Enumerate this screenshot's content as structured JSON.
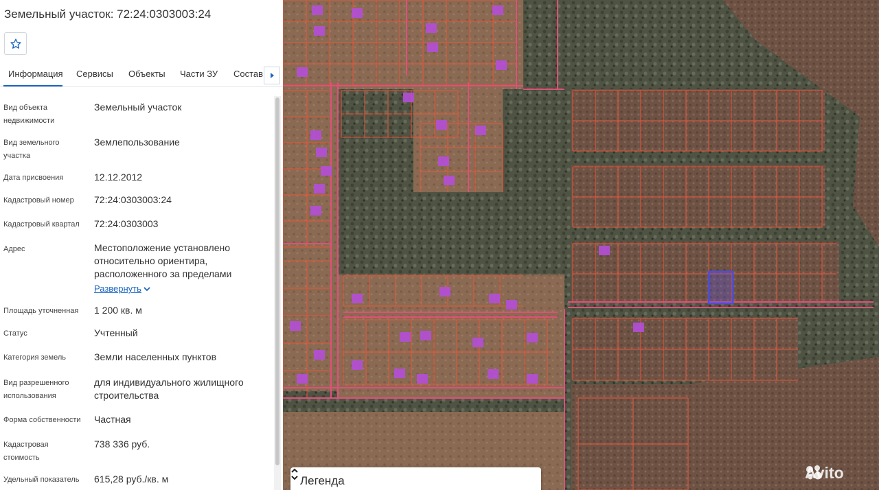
{
  "panel": {
    "title": "Земельный участок: 72:24:0303003:24",
    "favorite_icon": "star-outline-icon",
    "tabs": [
      {
        "label": "Информация",
        "active": true
      },
      {
        "label": "Сервисы"
      },
      {
        "label": "Объекты"
      },
      {
        "label": "Части ЗУ"
      },
      {
        "label": "Состав"
      }
    ],
    "tab_scroll_icon": "triangle-right-icon",
    "fields": [
      {
        "label": "Вид объекта недвижимости",
        "value": "Земельный участок"
      },
      {
        "label": "Вид земельного участка",
        "value": "Землепользование"
      },
      {
        "label": "Дата присвоения",
        "value": "12.12.2012"
      },
      {
        "label": "Кадастровый номер",
        "value": "72:24:0303003:24"
      },
      {
        "label": "Кадастровый квартал",
        "value": "72:24:0303003"
      },
      {
        "label": "Адрес",
        "value": "Местоположение установлено относительно ориентира, расположенного за пределами"
      },
      {
        "label": "Площадь уточненная",
        "value": "1 200 кв. м"
      },
      {
        "label": "Статус",
        "value": "Учтенный"
      },
      {
        "label": "Категория земель",
        "value": "Земли населенных пунктов"
      },
      {
        "label": "Вид разрешенного использования",
        "value": "для индивидуального жилищного строительства"
      },
      {
        "label": "Форма собственности",
        "value": "Частная"
      },
      {
        "label": "Кадастровая стоимость",
        "value": "738 336 руб."
      },
      {
        "label": "Удельный показатель",
        "value": "615,28 руб./кв. м"
      }
    ],
    "expand_label": "Развернуть",
    "expand_icon": "chevron-down-icon"
  },
  "map": {
    "legend_label": "Легенда",
    "legend_icon": "chevron-up-down-icon",
    "watermark_text": "Avito",
    "parcel_color": "#e8553a",
    "boundary_color": "#e0507a",
    "building_color": "#b44fd8",
    "selected_color": "#4b4de0"
  },
  "colors": {
    "accent": "#1a66c2"
  }
}
